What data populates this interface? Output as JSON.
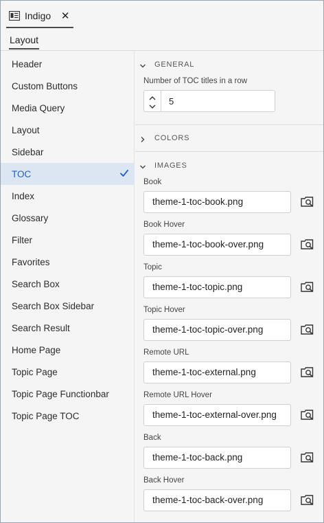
{
  "tab": {
    "label": "Indigo",
    "close": "✕"
  },
  "subtab": {
    "label": "Layout"
  },
  "sidebar": {
    "items": [
      {
        "label": "Header"
      },
      {
        "label": "Custom Buttons"
      },
      {
        "label": "Media Query"
      },
      {
        "label": "Layout"
      },
      {
        "label": "Sidebar"
      },
      {
        "label": "TOC",
        "selected": true
      },
      {
        "label": "Index"
      },
      {
        "label": "Glossary"
      },
      {
        "label": "Filter"
      },
      {
        "label": "Favorites"
      },
      {
        "label": "Search Box"
      },
      {
        "label": "Search Box Sidebar"
      },
      {
        "label": "Search Result"
      },
      {
        "label": "Home Page"
      },
      {
        "label": "Topic Page"
      },
      {
        "label": "Topic Page Functionbar"
      },
      {
        "label": "Topic Page TOC"
      }
    ]
  },
  "general": {
    "title": "GENERAL",
    "expanded": true,
    "toc_titles_label": "Number of TOC titles in a row",
    "toc_titles_value": "5"
  },
  "colors": {
    "title": "COLORS",
    "expanded": false
  },
  "images": {
    "title": "IMAGES",
    "expanded": true,
    "fields": [
      {
        "label": "Book",
        "value": "theme-1-toc-book.png"
      },
      {
        "label": "Book Hover",
        "value": "theme-1-toc-book-over.png"
      },
      {
        "label": "Topic",
        "value": "theme-1-toc-topic.png"
      },
      {
        "label": "Topic Hover",
        "value": "theme-1-toc-topic-over.png"
      },
      {
        "label": "Remote URL",
        "value": "theme-1-toc-external.png"
      },
      {
        "label": "Remote URL Hover",
        "value": "theme-1-toc-external-over.png"
      },
      {
        "label": "Back",
        "value": "theme-1-toc-back.png"
      },
      {
        "label": "Back Hover",
        "value": "theme-1-toc-back-over.png"
      }
    ]
  },
  "colors_palette": {
    "accent": "#1f5fbf",
    "selected_bg": "#dce6f3"
  },
  "icons": {
    "tab": "panel-icon",
    "check": "checkmark-icon",
    "expand": "chevron-down-icon",
    "collapse": "chevron-right-icon",
    "browse": "browse-image-icon"
  }
}
